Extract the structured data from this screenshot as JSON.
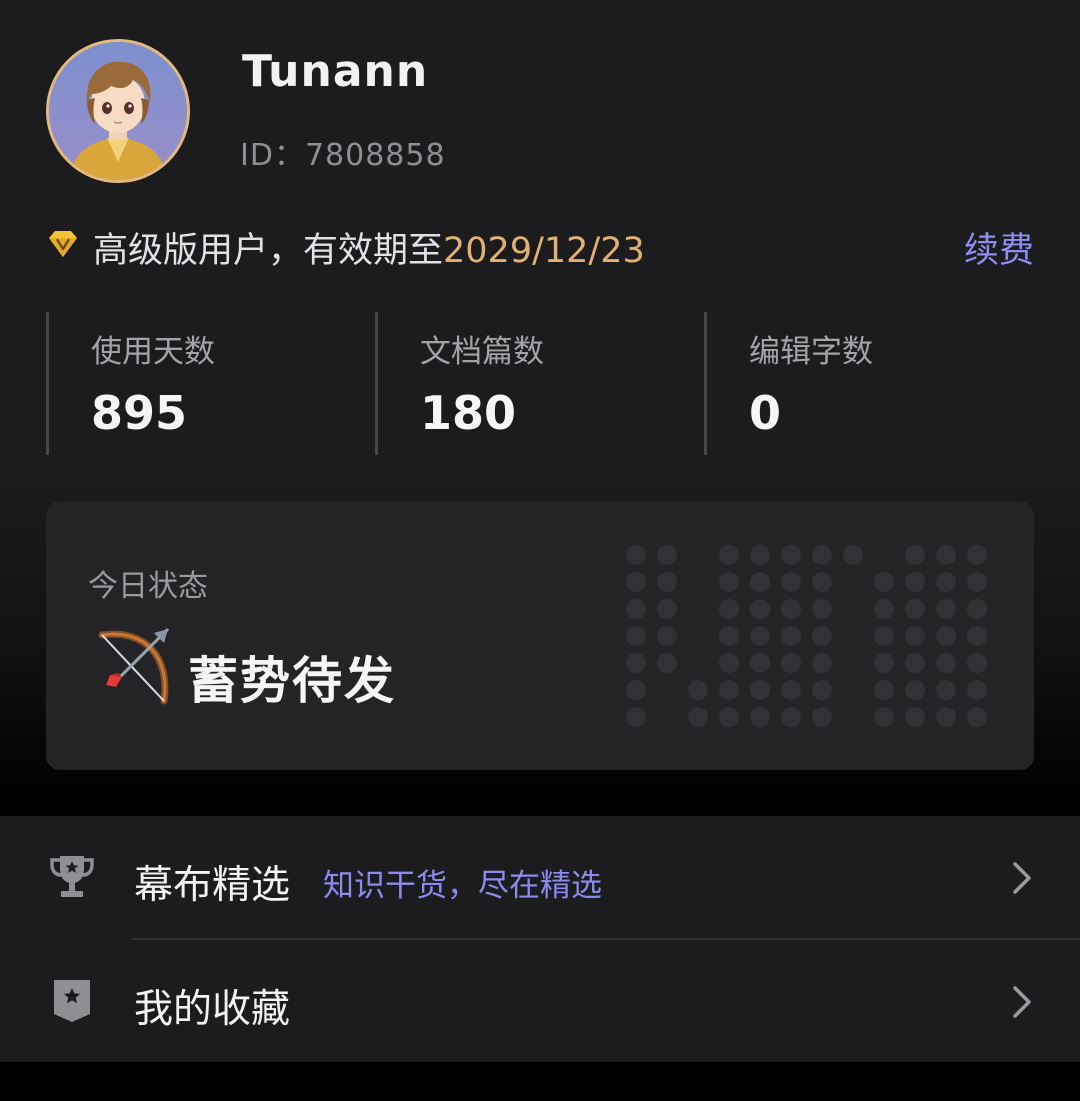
{
  "profile": {
    "username": "Tunann",
    "user_id": "ID：7808858",
    "avatar_icon": "avatar-anime-boy"
  },
  "membership": {
    "icon": "diamond-v-icon",
    "text_prefix": "高级版用户，有效期至",
    "expiry_date": "2029/12/23",
    "renew_label": "续费"
  },
  "stats": [
    {
      "label": "使用天数",
      "value": "895"
    },
    {
      "label": "文档篇数",
      "value": "180"
    },
    {
      "label": "编辑字数",
      "value": "0"
    }
  ],
  "today_status": {
    "label": "今日状态",
    "icon": "bow-and-arrow-emoji",
    "value": "蓄势待发"
  },
  "menu": [
    {
      "icon": "trophy-icon",
      "title": "幕布精选",
      "subtitle": "知识干货，尽在精选"
    },
    {
      "icon": "bookmark-star-icon",
      "title": "我的收藏",
      "subtitle": ""
    }
  ],
  "colors": {
    "background": "#1c1c1e",
    "card": "#242427",
    "accent_purple": "#8f8cf2",
    "accent_gold": "#e2b070",
    "text_primary": "#f2f2f4",
    "text_secondary": "#8e8e93"
  }
}
